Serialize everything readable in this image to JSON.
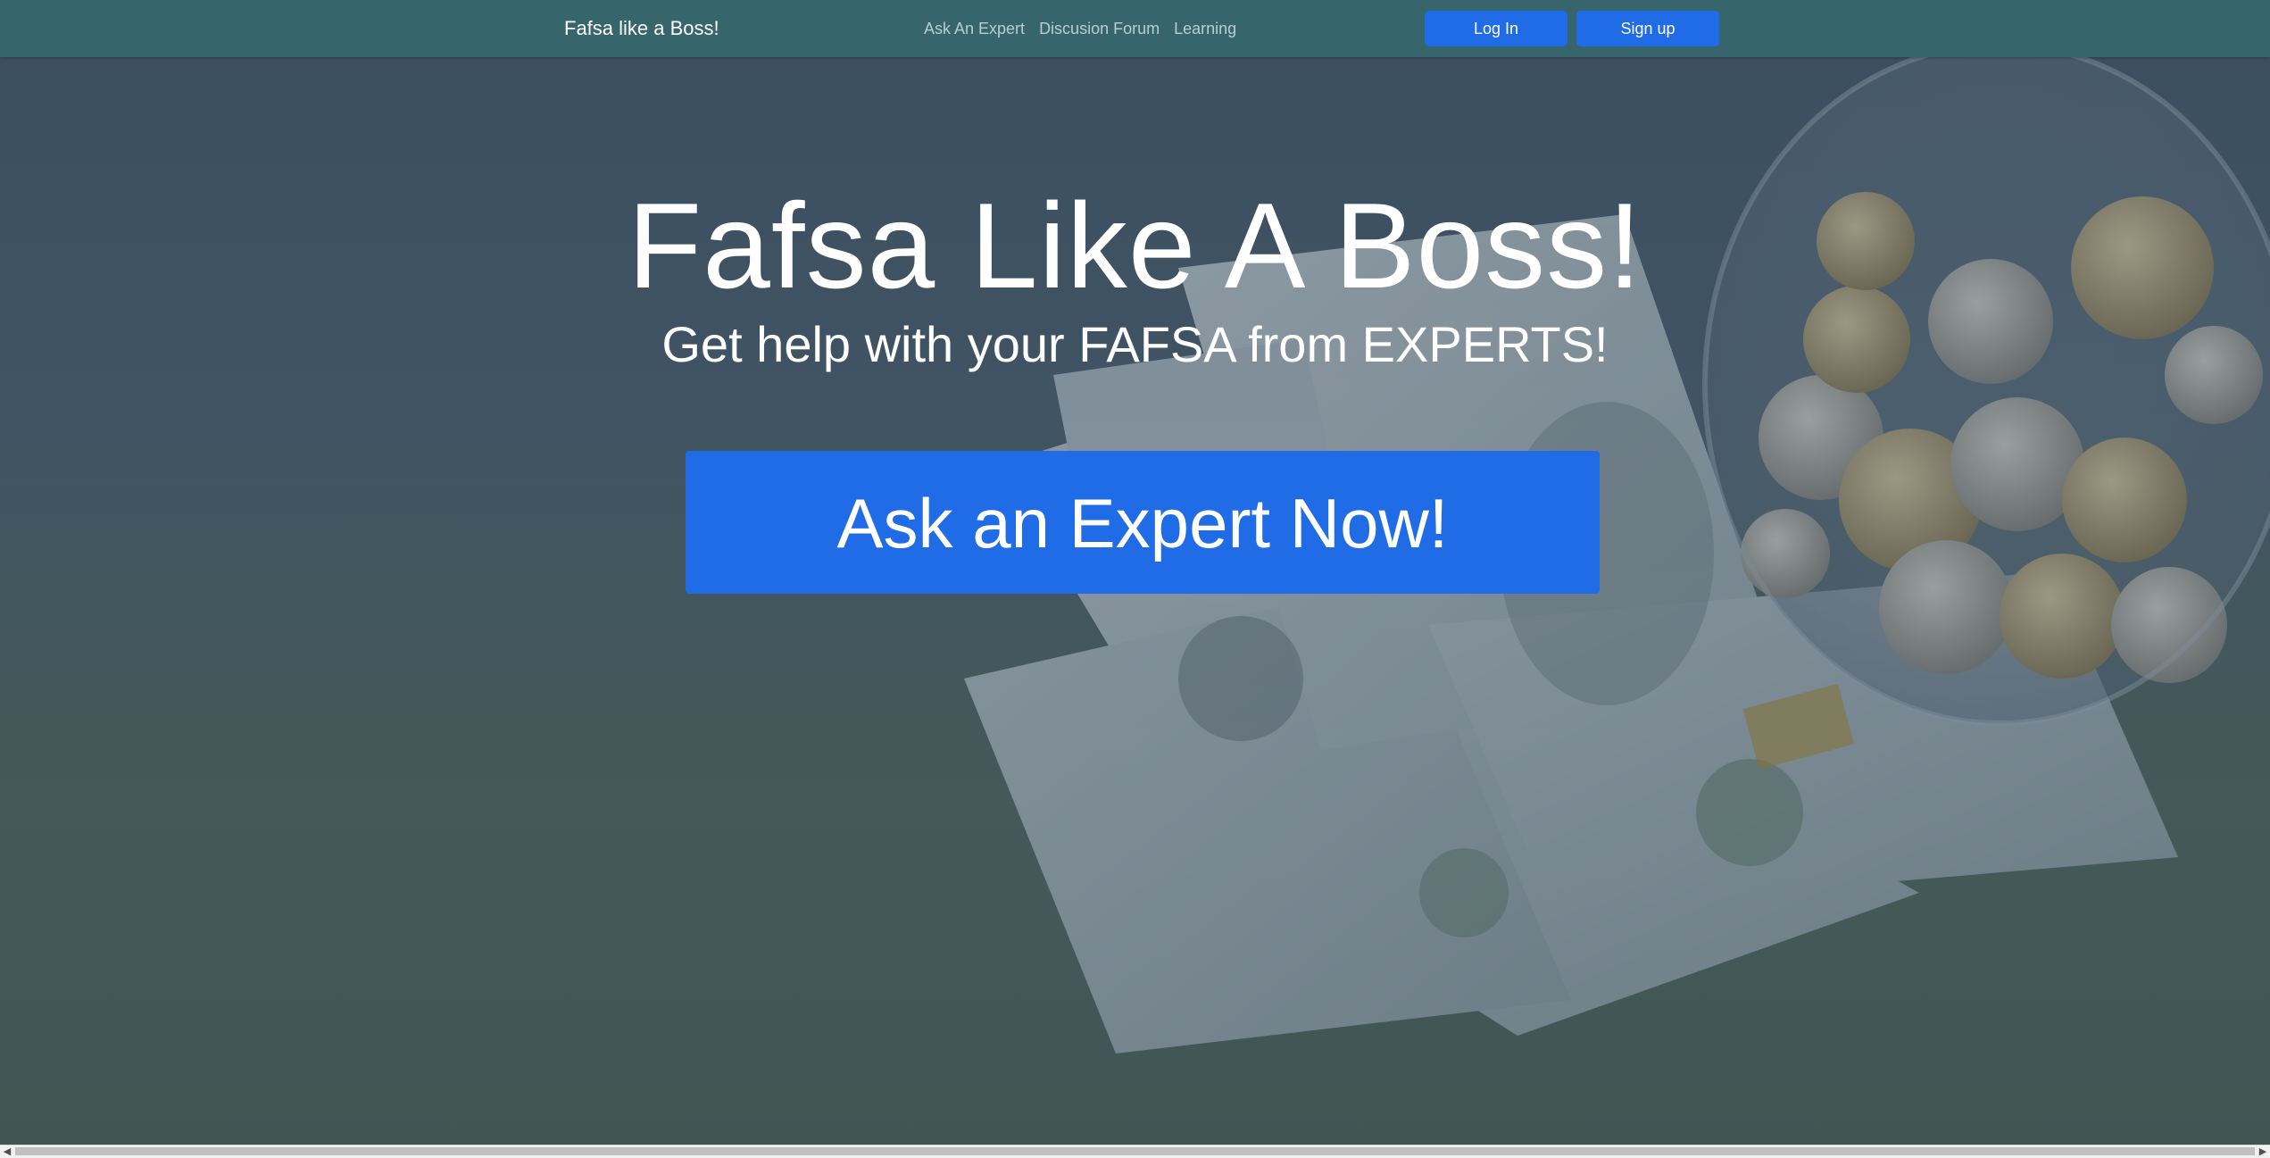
{
  "navbar": {
    "brand": "Fafsa like a Boss!",
    "links": [
      "Ask An Expert",
      "Discusion Forum",
      "Learning"
    ],
    "login_label": "Log In",
    "signup_label": "Sign up"
  },
  "hero": {
    "title": "Fafsa Like A Boss!",
    "subtitle": "Get help with your FAFSA from EXPERTS!",
    "cta_label": "Ask an Expert Now!"
  },
  "colors": {
    "navbar": "#37656c",
    "accent": "#1f6ce6",
    "nav_link": "#b8cdd2",
    "text": "#ffffff"
  },
  "scrollbar": {
    "left_arrow_icon": "chevron-left-icon",
    "right_arrow_icon": "chevron-right-icon"
  }
}
